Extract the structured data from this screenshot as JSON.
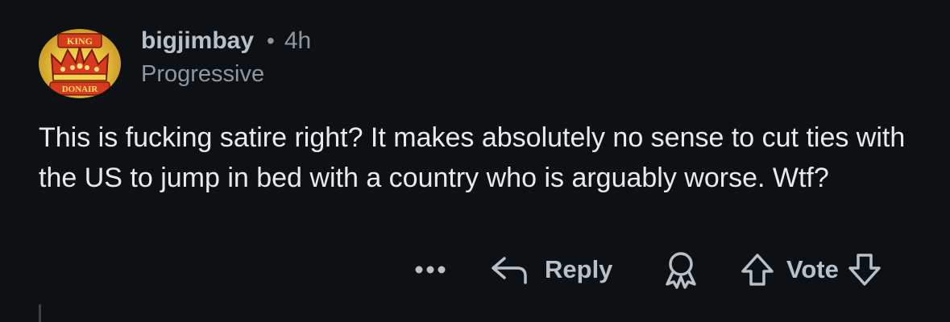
{
  "comment": {
    "avatar": {
      "top_text": "KING",
      "bottom_text": "DONAIR"
    },
    "username": "bigjimbay",
    "separator": "•",
    "time_ago": "4h",
    "flair": "Progressive",
    "body": "This is fucking satire right? It makes absolutely no sense to cut ties with the US to jump in bed with a country who is arguably worse. Wtf?"
  },
  "actions": {
    "more_label": "•••",
    "reply_label": "Reply",
    "vote_label": "Vote"
  },
  "icons": {
    "more": "more-options-icon",
    "reply": "reply-arrow-icon",
    "award": "award-icon",
    "upvote": "upvote-arrow-icon",
    "downvote": "downvote-arrow-icon"
  },
  "colors": {
    "background": "#0e1113",
    "text": "#e8ebee",
    "muted": "#8c98a0",
    "action": "#b7c1c9"
  }
}
